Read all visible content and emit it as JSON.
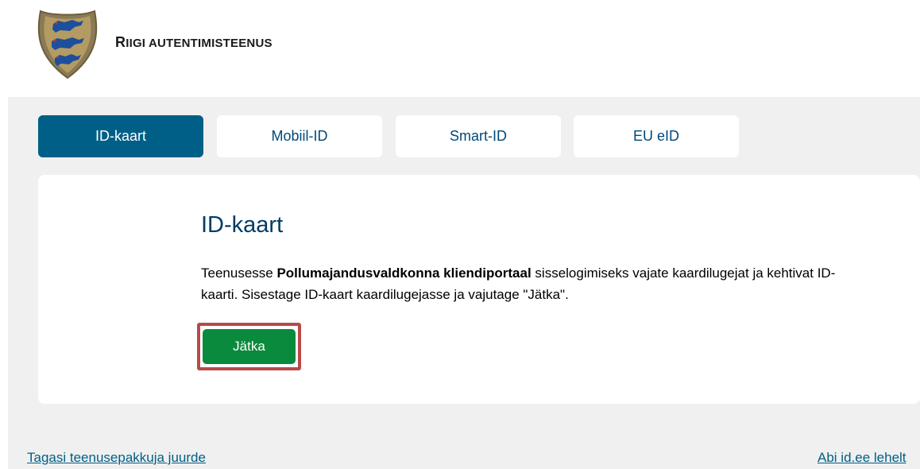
{
  "header": {
    "brand_lead": "R",
    "brand_rest": "IIGI AUTENTIMISTEENUS",
    "logo_icon": "estonian-coat-of-arms-icon"
  },
  "tabs": [
    {
      "label": "ID-kaart",
      "active": true
    },
    {
      "label": "Mobiil-ID",
      "active": false
    },
    {
      "label": "Smart-ID",
      "active": false
    },
    {
      "label": "EU eID",
      "active": false
    }
  ],
  "card": {
    "title": "ID-kaart",
    "text_before": "Teenusesse ",
    "service_name": "Pollumajandusvaldkonna kliendiportaal",
    "text_after": " sisselogimiseks vajate kaardilugejat ja kehtivat ID-kaarti. Sisestage ID-kaart kaardilugejasse ja vajutage \"Jätka\".",
    "continue_label": "Jätka"
  },
  "footer": {
    "back_link": "Tagasi teenusepakkuja juurde",
    "help_link": "Abi id.ee lehelt"
  },
  "colors": {
    "active_tab": "#005f86",
    "tab_text": "#00497a",
    "continue_button": "#0a8a3d",
    "highlight_border": "#b84a48",
    "title": "#003b64"
  }
}
